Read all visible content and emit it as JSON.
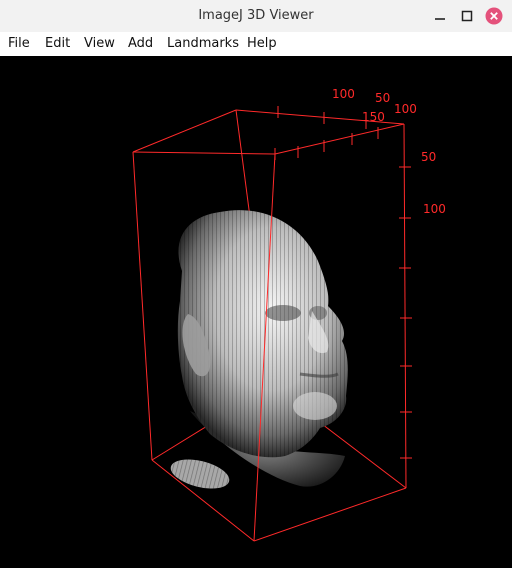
{
  "window": {
    "title": "ImageJ 3D Viewer",
    "buttons": {
      "minimize": "minimize",
      "maximize": "maximize",
      "close": "close"
    }
  },
  "menu": {
    "items": [
      {
        "label": "File"
      },
      {
        "label": "Edit"
      },
      {
        "label": "View"
      },
      {
        "label": "Add"
      },
      {
        "label": "Landmarks"
      },
      {
        "label": "Help"
      }
    ]
  },
  "viewer": {
    "bounding_box_color": "#ff2a2a",
    "background": "#000000",
    "axis_labels": {
      "x_top_100": "100",
      "x_top_50": "50",
      "x_top_150": "150",
      "x_top_100b": "100",
      "y_50": "50",
      "y_100": "100"
    },
    "volume": "head-volume-render"
  }
}
